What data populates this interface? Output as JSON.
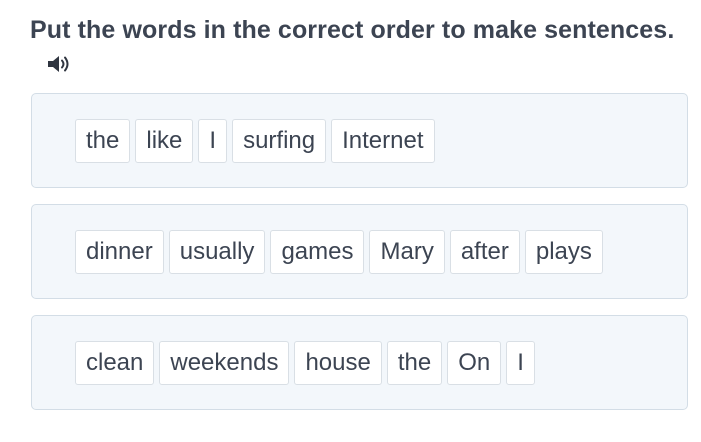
{
  "instruction": {
    "title": "Put the words in the correct order to make sentences.",
    "audio_icon": "speaker-volume-icon"
  },
  "exercises": [
    {
      "words": [
        "the",
        "like",
        "I",
        "surfing",
        "Internet"
      ]
    },
    {
      "words": [
        "dinner",
        "usually",
        "games",
        "Mary",
        "after",
        "plays"
      ]
    },
    {
      "words": [
        "clean",
        "weekends",
        "house",
        "the",
        "On",
        "I"
      ]
    }
  ],
  "colors": {
    "text": "#3c4452",
    "panel_background": "#f3f7fb",
    "panel_border": "#d3dde6",
    "chip_background": "#ffffff",
    "chip_border": "#d9dfe5"
  }
}
